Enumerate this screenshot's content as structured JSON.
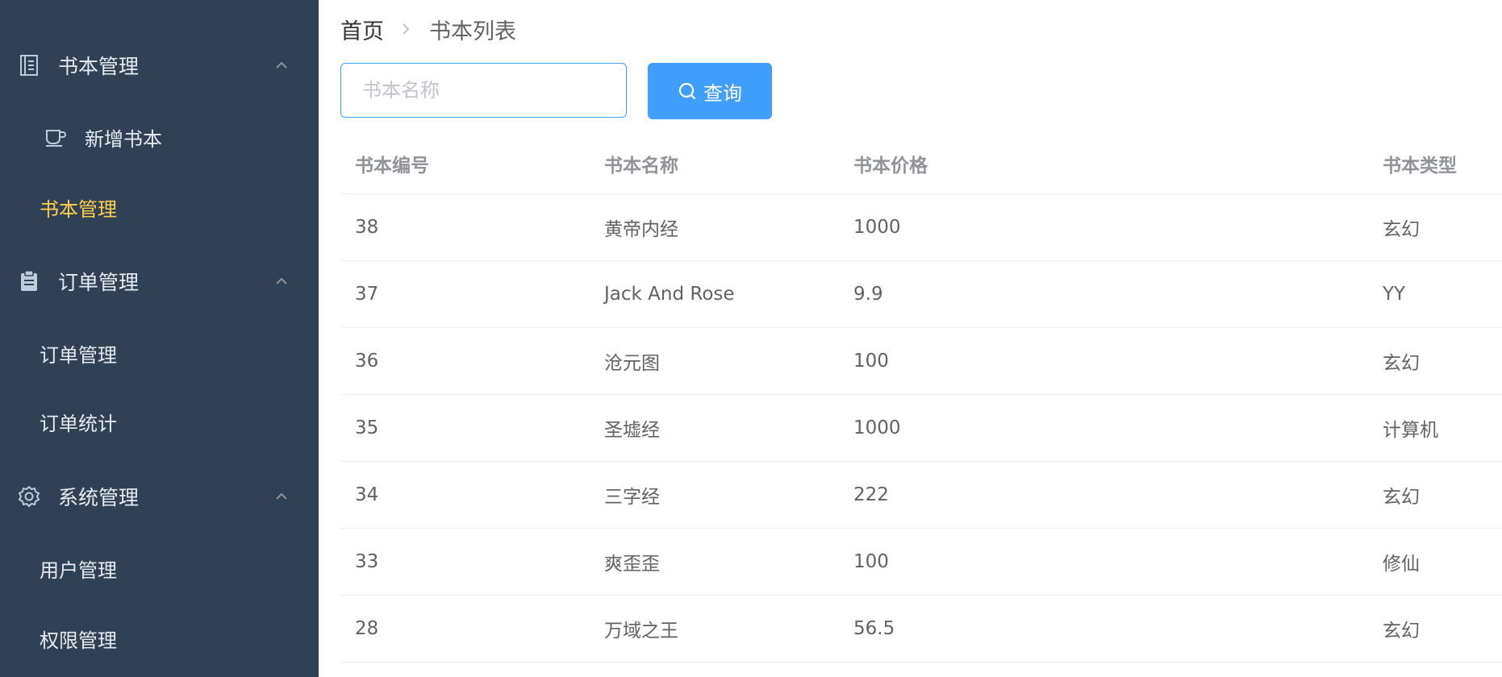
{
  "sidebar": {
    "groups": [
      {
        "title": "书本管理",
        "icon": "book-icon",
        "items": [
          {
            "label": "新增书本",
            "icon": "cup-icon"
          },
          {
            "label": "书本管理",
            "active": true
          }
        ]
      },
      {
        "title": "订单管理",
        "icon": "clipboard-icon",
        "items": [
          {
            "label": "订单管理"
          },
          {
            "label": "订单统计"
          }
        ]
      },
      {
        "title": "系统管理",
        "icon": "gear-icon",
        "items": [
          {
            "label": "用户管理"
          },
          {
            "label": "权限管理"
          }
        ]
      }
    ]
  },
  "breadcrumb": {
    "home": "首页",
    "current": "书本列表"
  },
  "search": {
    "placeholder": "书本名称",
    "value": "",
    "button_label": "查询"
  },
  "table": {
    "columns": [
      "书本编号",
      "书本名称",
      "书本价格",
      "书本类型"
    ],
    "rows": [
      {
        "id": "38",
        "name": "黄帝内经",
        "price": "1000",
        "type": "玄幻"
      },
      {
        "id": "37",
        "name": "Jack And Rose",
        "price": "9.9",
        "type": "YY"
      },
      {
        "id": "36",
        "name": "沧元图",
        "price": "100",
        "type": "玄幻"
      },
      {
        "id": "35",
        "name": "圣墟经",
        "price": "1000",
        "type": "计算机"
      },
      {
        "id": "34",
        "name": "三字经",
        "price": "222",
        "type": "玄幻"
      },
      {
        "id": "33",
        "name": "爽歪歪",
        "price": "100",
        "type": "修仙"
      },
      {
        "id": "28",
        "name": "万域之王",
        "price": "56.5",
        "type": "玄幻"
      }
    ]
  },
  "colors": {
    "sidebar_bg": "#304156",
    "active_item": "#ffd04b",
    "primary": "#409eff"
  }
}
